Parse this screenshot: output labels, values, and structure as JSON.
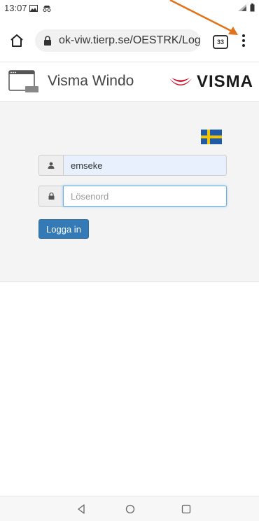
{
  "status_bar": {
    "time": "13:07"
  },
  "browser": {
    "url": "ok-viw.tierp.se/OESTRK/Logi",
    "tab_count": "33"
  },
  "app": {
    "title": "Visma Windo",
    "logo_badge": "",
    "brand": "VISMA"
  },
  "login": {
    "username_value": "emseke",
    "password_placeholder": "Lösenord",
    "submit_label": "Logga in",
    "language": "Swedish"
  },
  "colors": {
    "primary_button": "#337ab7",
    "annotation_arrow": "#e0741d",
    "visma_red": "#d0102b"
  }
}
